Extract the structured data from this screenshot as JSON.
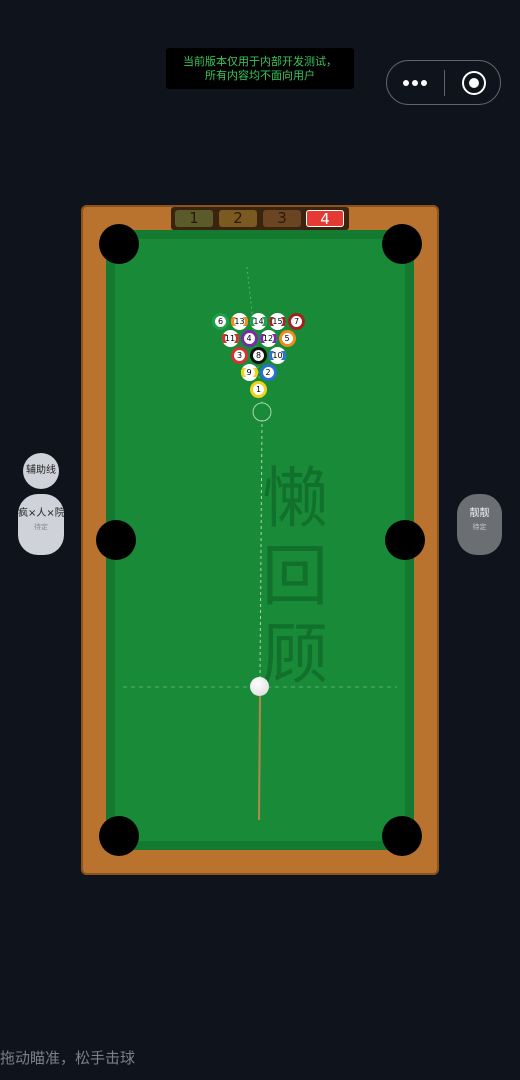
{
  "banner": {
    "line1": "当前版本仅用于内部开发测试，",
    "line2": "所有内容均不面向用户"
  },
  "capsule": {
    "menu_icon": "more-dots-icon",
    "close_icon": "target-circle-icon"
  },
  "shots": [
    "1",
    "2",
    "3",
    "4"
  ],
  "active_shot": "4",
  "watermark": [
    "懒",
    "回",
    "顾"
  ],
  "balls": [
    {
      "n": "6",
      "color": "#1ea04a",
      "stripe": false
    },
    {
      "n": "13",
      "color": "#f28a1c",
      "stripe": true
    },
    {
      "n": "14",
      "color": "#1ea04a",
      "stripe": true
    },
    {
      "n": "15",
      "color": "#9a2a2a",
      "stripe": true
    },
    {
      "n": "7",
      "color": "#a3221f",
      "stripe": false
    },
    {
      "n": "11",
      "color": "#d63030",
      "stripe": true
    },
    {
      "n": "4",
      "color": "#7a2aa8",
      "stripe": false
    },
    {
      "n": "12",
      "color": "#7a2aa8",
      "stripe": true
    },
    {
      "n": "5",
      "color": "#f28a1c",
      "stripe": false
    },
    {
      "n": "3",
      "color": "#d63030",
      "stripe": false
    },
    {
      "n": "8",
      "color": "#111111",
      "stripe": false
    },
    {
      "n": "10",
      "color": "#2a6fd6",
      "stripe": true
    },
    {
      "n": "9",
      "color": "#f2d21c",
      "stripe": true
    },
    {
      "n": "2",
      "color": "#2a6fd6",
      "stripe": false
    },
    {
      "n": "1",
      "color": "#f2d21c",
      "stripe": false
    }
  ],
  "left_controls": {
    "aux_line": "辅助线",
    "player_name": "疯×人×院",
    "player_status": "待定"
  },
  "right_controls": {
    "player_name": "靓靓",
    "player_status": "待定"
  },
  "hint": "拖动瞄准，松手击球"
}
